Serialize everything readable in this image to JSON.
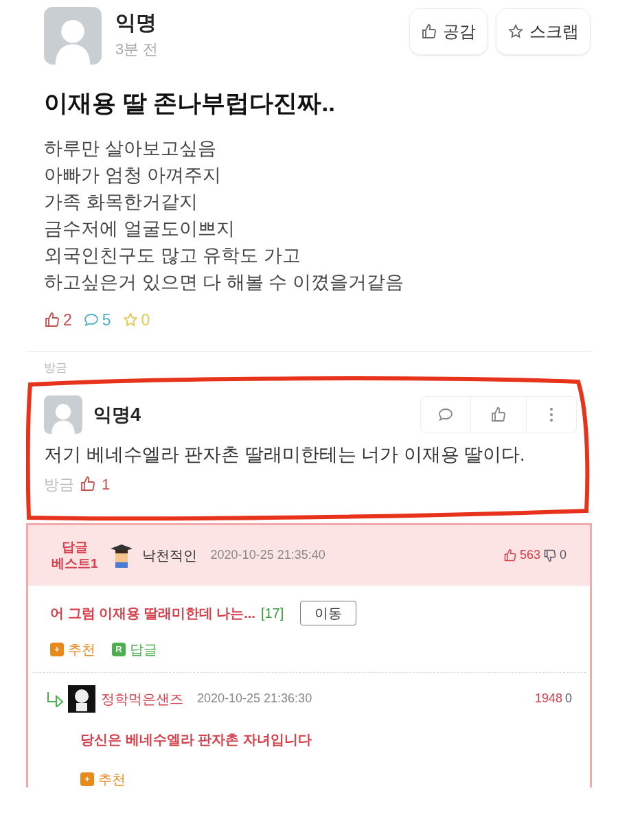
{
  "post": {
    "author": "익명",
    "time": "3분 전",
    "actions": [
      {
        "kind": "like",
        "label": "공감"
      },
      {
        "kind": "scrap",
        "label": "스크랩"
      }
    ],
    "title": "이재용 딸 존나부럽다진짜..",
    "body": [
      "하루만 살아보고싶음",
      "아빠가 엄청 아껴주지",
      "가족 화목한거같지",
      "금수저에 얼굴도이쁘지",
      "외국인친구도 많고 유학도 가고",
      "하고싶은거 있으면 다 해볼 수 이꼈을거같음"
    ],
    "stats": [
      {
        "kind": "like",
        "count": "2",
        "color": "#c0504d"
      },
      {
        "kind": "comment",
        "count": "5",
        "color": "#4fb0c6"
      },
      {
        "kind": "scrap",
        "count": "0",
        "color": "#e6c84a"
      }
    ]
  },
  "comment": {
    "above_time": "방금",
    "author": "익명4",
    "text": "저기 베네수엘라 판자촌 딸래미한테는 너가 이재용 딸이다.",
    "time": "방금",
    "likes": "1",
    "highlighted": true
  },
  "best_reply": {
    "badge": [
      "답글",
      "베스트1"
    ],
    "author": "낙천적인",
    "time": "2020-10-25 21:35:40",
    "up": "563",
    "down": "0",
    "text": "어 그럼 이재용 딸래미한데 나는...",
    "count": "[17]",
    "move_button": "이동",
    "actions": [
      {
        "icon": "+",
        "label": "추천",
        "color": "#e8891c"
      },
      {
        "icon": "R",
        "label": "답글",
        "color": "#4caf50"
      }
    ],
    "reply": {
      "author": "정학먹은샌즈",
      "time": "2020-10-25 21:36:30",
      "up": "1948",
      "down": "0",
      "text": "당신은 베네수엘라 판자촌 자녀입니다",
      "actions": [
        {
          "icon": "+",
          "label": "추천",
          "color": "#e8891c"
        }
      ]
    }
  }
}
